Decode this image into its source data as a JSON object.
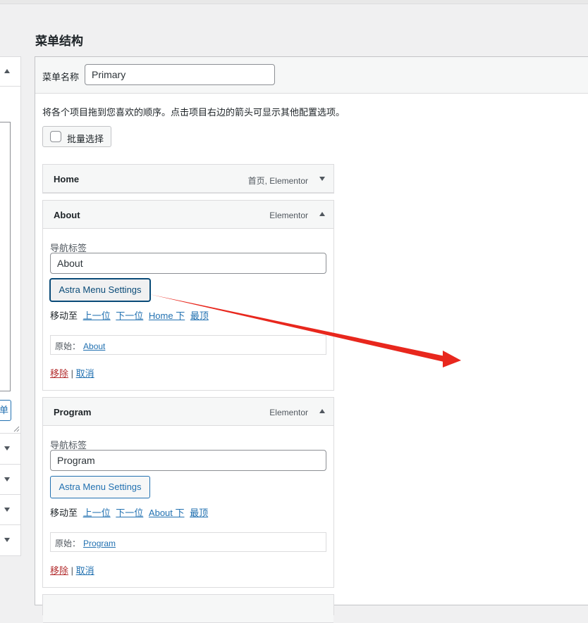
{
  "page_title": "菜单结构",
  "left_panel": {
    "button_fragment": "单"
  },
  "menu_name": {
    "label": "菜单名称",
    "value": "Primary"
  },
  "help_text": "将各个项目拖到您喜欢的顺序。点击项目右边的箭头可显示其他配置选项。",
  "bulk_select_label": "批量选择",
  "items": [
    {
      "title": "Home",
      "type": "首页, Elementor"
    },
    {
      "title": "About",
      "type": "Elementor",
      "nav_label": "导航标签",
      "nav_value": "About",
      "astra_btn": "Astra Menu Settings",
      "move_label": "移动至",
      "move_links": [
        "上一位",
        "下一位",
        "Home 下",
        "最顶"
      ],
      "original_label": "原始：",
      "original_link": "About",
      "remove": "移除",
      "separator": "|",
      "cancel": "取消"
    },
    {
      "title": "Program",
      "type": "Elementor",
      "nav_label": "导航标签",
      "nav_value": "Program",
      "astra_btn": "Astra Menu Settings",
      "move_label": "移动至",
      "move_links": [
        "上一位",
        "下一位",
        "About 下",
        "最顶"
      ],
      "original_label": "原始：",
      "original_link": "Program",
      "remove": "移除",
      "separator": "|",
      "cancel": "取消"
    }
  ],
  "colors": {
    "link": "#2271b1",
    "remove": "#b32d2e",
    "annotation_arrow": "#e8271d"
  }
}
